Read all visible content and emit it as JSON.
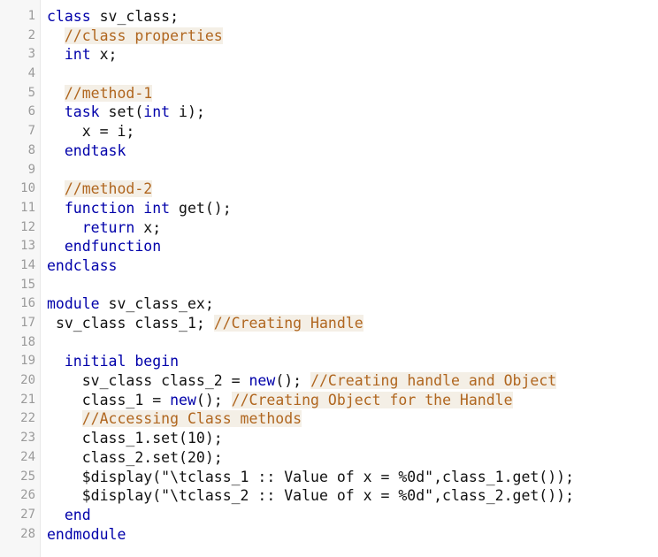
{
  "editor": {
    "colors": {
      "keyword": "#0000aa",
      "comment": "#b0661f",
      "comment_bg": "#f4efe6",
      "line_number": "#9a9a9a",
      "gutter_bg": "#f7f7f7"
    },
    "lines": [
      {
        "num": "1",
        "indent": "",
        "tokens": [
          {
            "t": "class",
            "k": "kw"
          },
          {
            "t": " sv_class;",
            "k": "plain"
          }
        ]
      },
      {
        "num": "2",
        "indent": "  ",
        "tokens": [
          {
            "t": "//class properties",
            "k": "comment"
          }
        ]
      },
      {
        "num": "3",
        "indent": "  ",
        "tokens": [
          {
            "t": "int",
            "k": "kw"
          },
          {
            "t": " x;",
            "k": "plain"
          }
        ]
      },
      {
        "num": "4",
        "indent": "",
        "tokens": []
      },
      {
        "num": "5",
        "indent": "  ",
        "tokens": [
          {
            "t": "//method-1",
            "k": "comment"
          }
        ]
      },
      {
        "num": "6",
        "indent": "  ",
        "tokens": [
          {
            "t": "task",
            "k": "kw"
          },
          {
            "t": " set(",
            "k": "plain"
          },
          {
            "t": "int",
            "k": "kw"
          },
          {
            "t": " i);",
            "k": "plain"
          }
        ]
      },
      {
        "num": "7",
        "indent": "    ",
        "tokens": [
          {
            "t": "x = i;",
            "k": "plain"
          }
        ]
      },
      {
        "num": "8",
        "indent": "  ",
        "tokens": [
          {
            "t": "endtask",
            "k": "kw"
          }
        ]
      },
      {
        "num": "9",
        "indent": "",
        "tokens": []
      },
      {
        "num": "10",
        "indent": "  ",
        "tokens": [
          {
            "t": "//method-2",
            "k": "comment"
          }
        ]
      },
      {
        "num": "11",
        "indent": "  ",
        "tokens": [
          {
            "t": "function",
            "k": "kw"
          },
          {
            "t": " ",
            "k": "plain"
          },
          {
            "t": "int",
            "k": "kw"
          },
          {
            "t": " get();",
            "k": "plain"
          }
        ]
      },
      {
        "num": "12",
        "indent": "    ",
        "tokens": [
          {
            "t": "return",
            "k": "kw"
          },
          {
            "t": " x;",
            "k": "plain"
          }
        ]
      },
      {
        "num": "13",
        "indent": "  ",
        "tokens": [
          {
            "t": "endfunction",
            "k": "kw"
          }
        ]
      },
      {
        "num": "14",
        "indent": "",
        "tokens": [
          {
            "t": "endclass",
            "k": "kw"
          }
        ]
      },
      {
        "num": "15",
        "indent": "",
        "tokens": []
      },
      {
        "num": "16",
        "indent": "",
        "tokens": [
          {
            "t": "module",
            "k": "kw"
          },
          {
            "t": " sv_class_ex;",
            "k": "plain"
          }
        ]
      },
      {
        "num": "17",
        "indent": " ",
        "tokens": [
          {
            "t": "sv_class class_1; ",
            "k": "plain"
          },
          {
            "t": "//Creating Handle",
            "k": "comment"
          }
        ]
      },
      {
        "num": "18",
        "indent": "",
        "tokens": []
      },
      {
        "num": "19",
        "indent": "  ",
        "tokens": [
          {
            "t": "initial",
            "k": "kw"
          },
          {
            "t": " ",
            "k": "plain"
          },
          {
            "t": "begin",
            "k": "kw"
          }
        ]
      },
      {
        "num": "20",
        "indent": "    ",
        "tokens": [
          {
            "t": "sv_class class_2 = ",
            "k": "plain"
          },
          {
            "t": "new",
            "k": "kw"
          },
          {
            "t": "(); ",
            "k": "plain"
          },
          {
            "t": "//Creating handle and Object",
            "k": "comment"
          }
        ]
      },
      {
        "num": "21",
        "indent": "    ",
        "tokens": [
          {
            "t": "class_1 = ",
            "k": "plain"
          },
          {
            "t": "new",
            "k": "kw"
          },
          {
            "t": "(); ",
            "k": "plain"
          },
          {
            "t": "//Creating Object for the Handle",
            "k": "comment"
          }
        ]
      },
      {
        "num": "22",
        "indent": "    ",
        "tokens": [
          {
            "t": "//Accessing Class methods",
            "k": "comment"
          }
        ]
      },
      {
        "num": "23",
        "indent": "    ",
        "tokens": [
          {
            "t": "class_1.set(10);",
            "k": "plain"
          }
        ]
      },
      {
        "num": "24",
        "indent": "    ",
        "tokens": [
          {
            "t": "class_2.set(20);",
            "k": "plain"
          }
        ]
      },
      {
        "num": "25",
        "indent": "    ",
        "tokens": [
          {
            "t": "$display(\"\\tclass_1 :: Value of x = %0d\",class_1.get());",
            "k": "plain"
          }
        ]
      },
      {
        "num": "26",
        "indent": "    ",
        "tokens": [
          {
            "t": "$display(\"\\tclass_2 :: Value of x = %0d\",class_2.get());",
            "k": "plain"
          }
        ]
      },
      {
        "num": "27",
        "indent": "  ",
        "tokens": [
          {
            "t": "end",
            "k": "kw"
          }
        ]
      },
      {
        "num": "28",
        "indent": "",
        "tokens": [
          {
            "t": "endmodule",
            "k": "kw"
          }
        ]
      }
    ]
  }
}
